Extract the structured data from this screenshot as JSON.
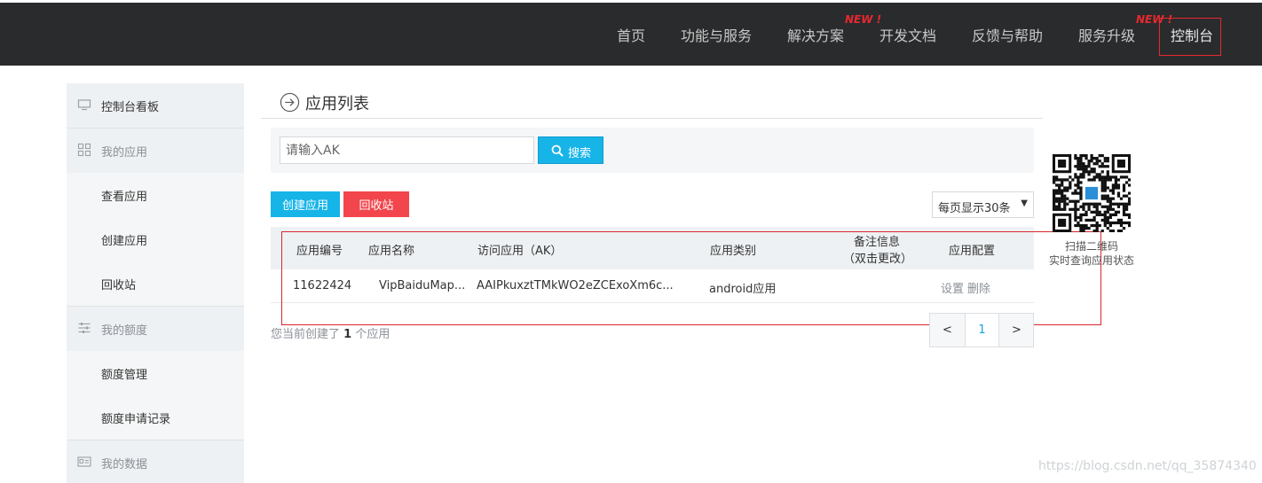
{
  "nav": {
    "items": [
      "首页",
      "功能与服务",
      "解决方案",
      "开发文档",
      "反馈与帮助",
      "服务升级",
      "控制台"
    ],
    "badge_new_1": "NEW !",
    "badge_new_2": "NEW !"
  },
  "sidebar": {
    "dashboard": "控制台看板",
    "my_apps": "我的应用",
    "view_apps": "查看应用",
    "create_app": "创建应用",
    "recycle_bin": "回收站",
    "my_quota": "我的额度",
    "quota_manage": "额度管理",
    "quota_apply_log": "额度申请记录",
    "my_data": "我的数据"
  },
  "page": {
    "title": "应用列表"
  },
  "search": {
    "placeholder": "请输入AK",
    "button": "搜索"
  },
  "actions": {
    "create": "创建应用",
    "recycle": "回收站",
    "per_page": "每页显示30条"
  },
  "table": {
    "headers": [
      "应用编号",
      "应用名称",
      "访问应用（AK）",
      "应用类别",
      "备注信息",
      "（双击更改）",
      "应用配置"
    ],
    "rows": [
      {
        "id": "11622424",
        "name": "VipBaiduMap...",
        "ak": "AAIPkuxztTMkWO2eZCExoXm6c...",
        "category": "android应用",
        "note": "",
        "settings": "设置",
        "delete": "删除"
      }
    ]
  },
  "footer": {
    "count_prefix": "您当前创建了",
    "count": "1",
    "count_suffix": "个应用"
  },
  "pager": {
    "prev": "<",
    "current": "1",
    "next": ">"
  },
  "qr": {
    "line1": "扫描二维码",
    "line2": "实时查询应用状态"
  },
  "watermark": "https://blog.csdn.net/qq_35874340",
  "colors": {
    "navbar": "#2a2b2d",
    "accent_blue": "#17b4e8",
    "danger_red": "#f2454c",
    "highlight_red": "#d9262c"
  }
}
